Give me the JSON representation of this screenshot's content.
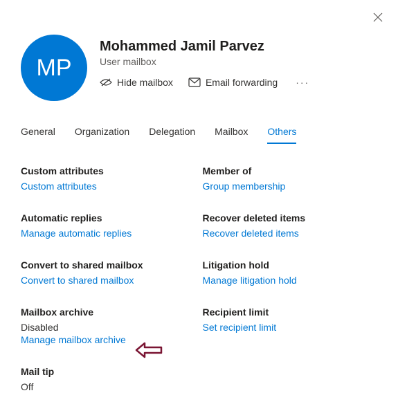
{
  "header": {
    "avatarInitials": "MP",
    "displayName": "Mohammed Jamil Parvez",
    "subtitle": "User mailbox"
  },
  "actions": {
    "hideMailbox": "Hide mailbox",
    "emailForwarding": "Email forwarding"
  },
  "tabs": {
    "general": "General",
    "organization": "Organization",
    "delegation": "Delegation",
    "mailbox": "Mailbox",
    "others": "Others"
  },
  "sections": {
    "customAttributes": {
      "title": "Custom attributes",
      "link": "Custom attributes"
    },
    "memberOf": {
      "title": "Member of",
      "link": "Group membership"
    },
    "automaticReplies": {
      "title": "Automatic replies",
      "link": "Manage automatic replies"
    },
    "recoverDeleted": {
      "title": "Recover deleted items",
      "link": "Recover deleted items"
    },
    "convertShared": {
      "title": "Convert to shared mailbox",
      "link": "Convert to shared mailbox"
    },
    "litigationHold": {
      "title": "Litigation hold",
      "link": "Manage litigation hold"
    },
    "mailboxArchive": {
      "title": "Mailbox archive",
      "status": "Disabled",
      "link": "Manage mailbox archive"
    },
    "recipientLimit": {
      "title": "Recipient limit",
      "link": "Set recipient limit"
    },
    "mailTip": {
      "title": "Mail tip",
      "status": "Off"
    }
  }
}
